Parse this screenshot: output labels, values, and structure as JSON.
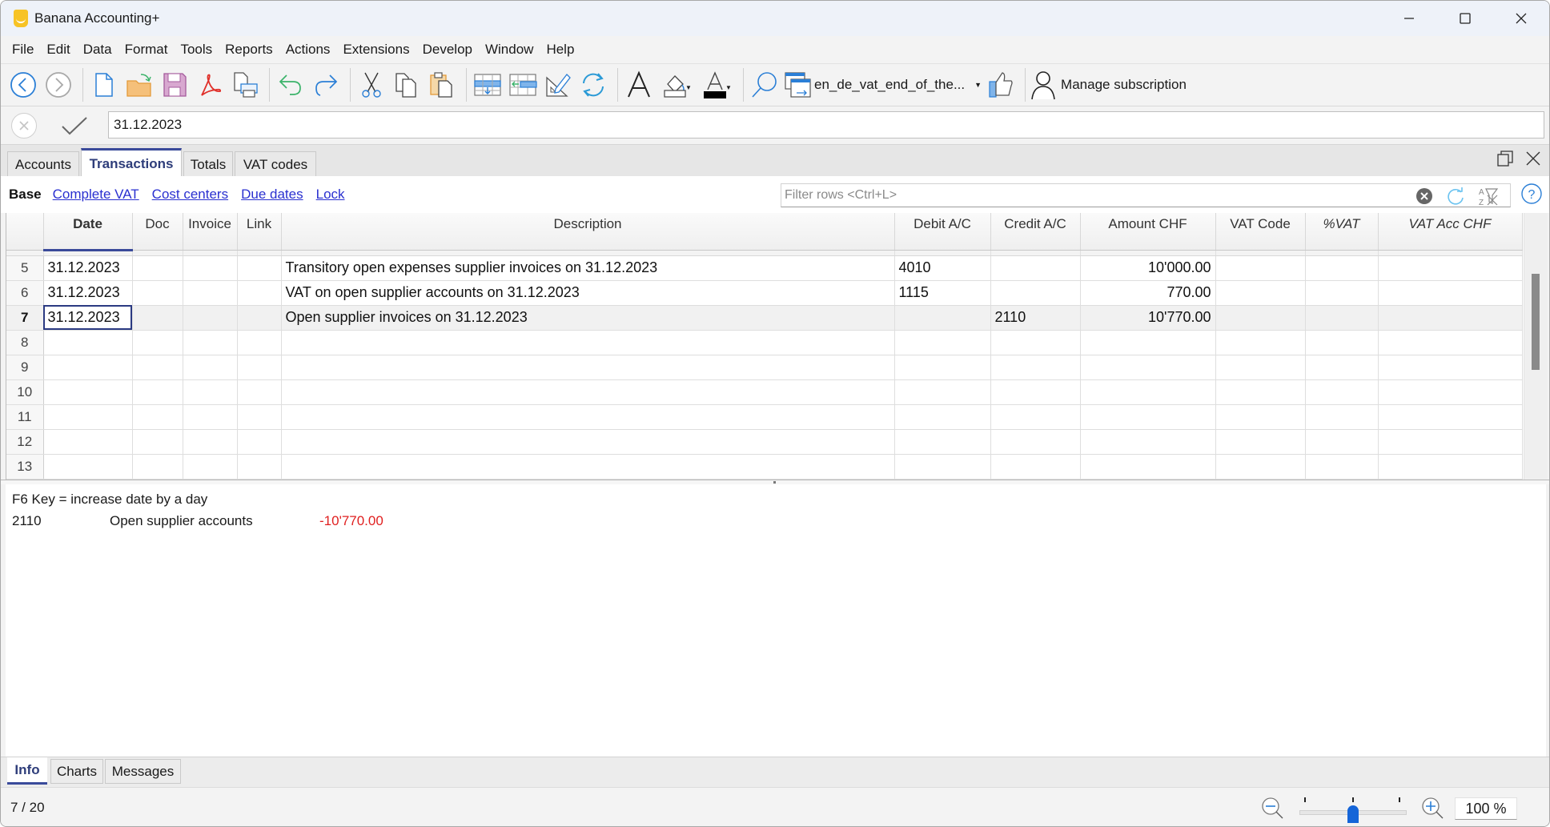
{
  "window": {
    "title": "Banana Accounting+",
    "controls": {
      "minimize": "—",
      "maximize": "☐",
      "close": "✕"
    }
  },
  "menu": [
    "File",
    "Edit",
    "Data",
    "Format",
    "Tools",
    "Reports",
    "Actions",
    "Extensions",
    "Develop",
    "Window",
    "Help"
  ],
  "toolbar": {
    "file_selector_label": "en_de_vat_end_of_the...",
    "subscription_label": "Manage subscription"
  },
  "editbar": {
    "value": "31.12.2023"
  },
  "table_tabs": [
    {
      "label": "Accounts",
      "active": false
    },
    {
      "label": "Transactions",
      "active": true
    },
    {
      "label": "Totals",
      "active": false
    },
    {
      "label": "VAT codes",
      "active": false
    }
  ],
  "views": [
    {
      "label": "Base",
      "active": true
    },
    {
      "label": "Complete VAT",
      "active": false
    },
    {
      "label": "Cost centers",
      "active": false
    },
    {
      "label": "Due dates",
      "active": false
    },
    {
      "label": "Lock",
      "active": false
    }
  ],
  "filter": {
    "placeholder": "Filter rows <Ctrl+L>",
    "value": ""
  },
  "grid": {
    "columns": [
      "",
      "Date",
      "Doc",
      "Invoice",
      "Link",
      "Description",
      "Debit A/C",
      "Credit A/C",
      "Amount CHF",
      "VAT Code",
      "%VAT",
      "VAT Acc CHF"
    ],
    "rows": [
      {
        "num": "5",
        "date": "31.12.2023",
        "doc": "",
        "invoice": "",
        "link": "",
        "description": "Transitory open expenses supplier invoices on 31.12.2023",
        "debit": "4010",
        "credit": "",
        "amount": "10'000.00",
        "vat_code": "",
        "vat_pct": "",
        "vat_acc": ""
      },
      {
        "num": "6",
        "date": "31.12.2023",
        "doc": "",
        "invoice": "",
        "link": "",
        "description": "VAT on open supplier accounts on 31.12.2023",
        "debit": "1115",
        "credit": "",
        "amount": "770.00",
        "vat_code": "",
        "vat_pct": "",
        "vat_acc": ""
      },
      {
        "num": "7",
        "date": "31.12.2023",
        "doc": "",
        "invoice": "",
        "link": "",
        "description": "Open supplier invoices on 31.12.2023",
        "debit": "",
        "credit": "2110",
        "amount": "10'770.00",
        "vat_code": "",
        "vat_pct": "",
        "vat_acc": ""
      },
      {
        "num": "8",
        "date": "",
        "doc": "",
        "invoice": "",
        "link": "",
        "description": "",
        "debit": "",
        "credit": "",
        "amount": "",
        "vat_code": "",
        "vat_pct": "",
        "vat_acc": ""
      },
      {
        "num": "9",
        "date": "",
        "doc": "",
        "invoice": "",
        "link": "",
        "description": "",
        "debit": "",
        "credit": "",
        "amount": "",
        "vat_code": "",
        "vat_pct": "",
        "vat_acc": ""
      },
      {
        "num": "10",
        "date": "",
        "doc": "",
        "invoice": "",
        "link": "",
        "description": "",
        "debit": "",
        "credit": "",
        "amount": "",
        "vat_code": "",
        "vat_pct": "",
        "vat_acc": ""
      },
      {
        "num": "11",
        "date": "",
        "doc": "",
        "invoice": "",
        "link": "",
        "description": "",
        "debit": "",
        "credit": "",
        "amount": "",
        "vat_code": "",
        "vat_pct": "",
        "vat_acc": ""
      },
      {
        "num": "12",
        "date": "",
        "doc": "",
        "invoice": "",
        "link": "",
        "description": "",
        "debit": "",
        "credit": "",
        "amount": "",
        "vat_code": "",
        "vat_pct": "",
        "vat_acc": ""
      },
      {
        "num": "13",
        "date": "",
        "doc": "",
        "invoice": "",
        "link": "",
        "description": "",
        "debit": "",
        "credit": "",
        "amount": "",
        "vat_code": "",
        "vat_pct": "",
        "vat_acc": ""
      }
    ],
    "current_row": "7"
  },
  "info": {
    "hint": "F6 Key = increase date by a day",
    "account": "2110",
    "account_description": "Open supplier accounts",
    "balance": "-10'770.00",
    "balance_color": "#e02020"
  },
  "bottom_tabs": [
    {
      "label": "Info",
      "active": true
    },
    {
      "label": "Charts",
      "active": false
    },
    {
      "label": "Messages",
      "active": false
    }
  ],
  "status": {
    "row_position": "7 / 20",
    "zoom_value": "100 %",
    "zoom_percent": 100
  },
  "colors": {
    "accent": "#3a4a9a",
    "link": "#2a30d0",
    "negative": "#e02020",
    "slider": "#1565d8"
  }
}
